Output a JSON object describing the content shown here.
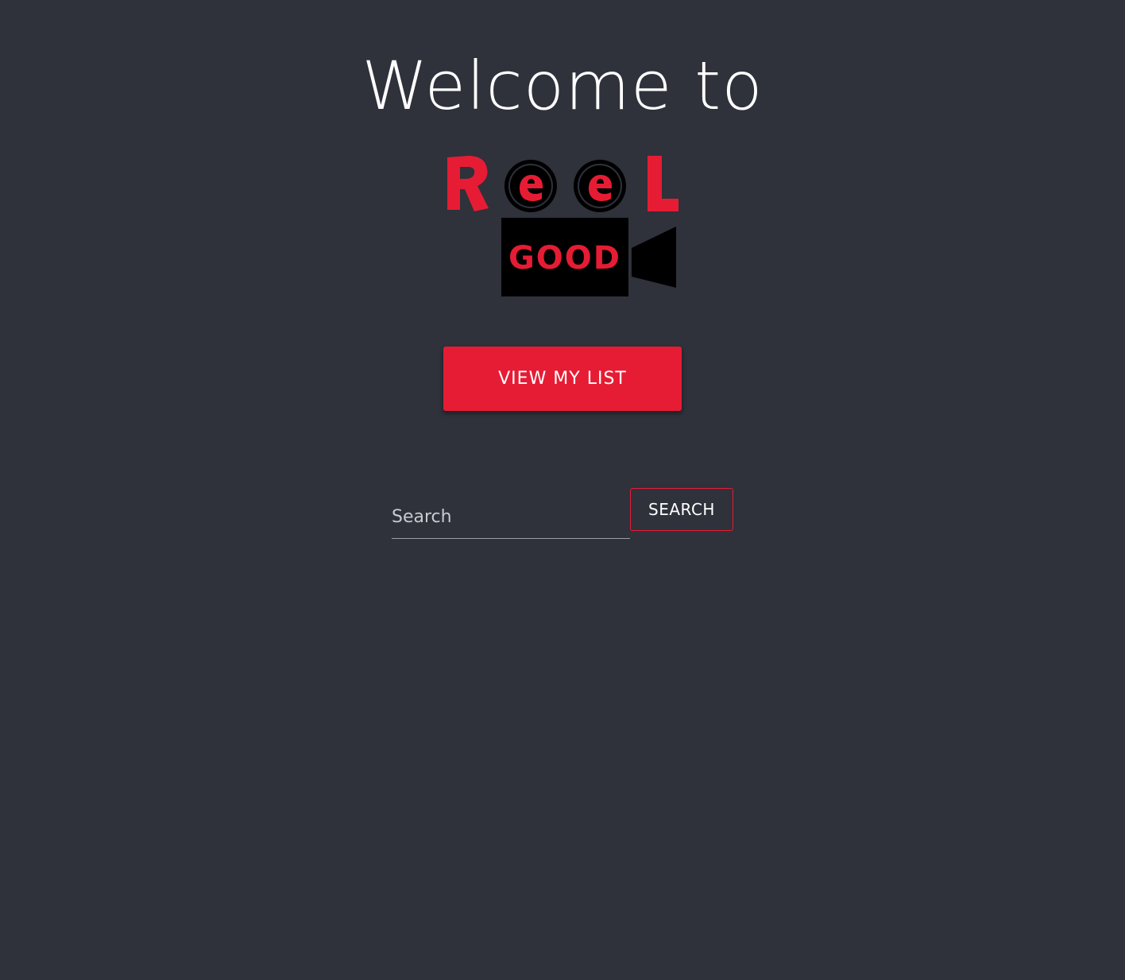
{
  "header": {
    "welcome_text": "Welcome to"
  },
  "logo": {
    "wordmark_top": "ReeL",
    "wordmark_bottom": "GOOD",
    "icon": "film-camera-icon",
    "colors": {
      "red": "#e61c34",
      "black": "#000000"
    }
  },
  "actions": {
    "view_list_label": "VIEW MY LIST"
  },
  "search": {
    "placeholder": "Search",
    "value": "",
    "button_label": "SEARCH"
  },
  "theme": {
    "background": "#2f313b",
    "accent": "#e61c34"
  }
}
